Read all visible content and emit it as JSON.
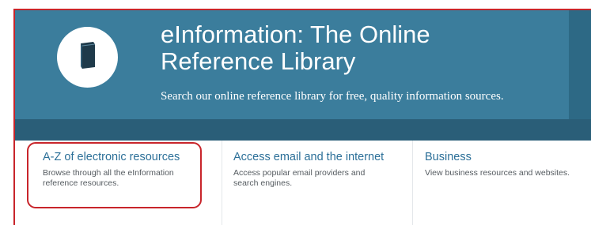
{
  "hero": {
    "title_line1": "eInformation: The Online",
    "title_line2": "Reference Library",
    "subtitle": "Search our online reference library for free, quality information sources.",
    "icon": "book-icon"
  },
  "cards": [
    {
      "title": "A-Z of electronic resources",
      "description": "Browse through all the eInformation reference resources."
    },
    {
      "title": "Access email and the internet",
      "description": "Access popular email providers and search engines."
    },
    {
      "title": "Business",
      "description": "View business resources and websites."
    }
  ],
  "colors": {
    "hero_bg": "#3b7d9c",
    "hero_strip": "#2a5e78",
    "accent": "#2b6f98",
    "highlight": "#c8252b"
  }
}
